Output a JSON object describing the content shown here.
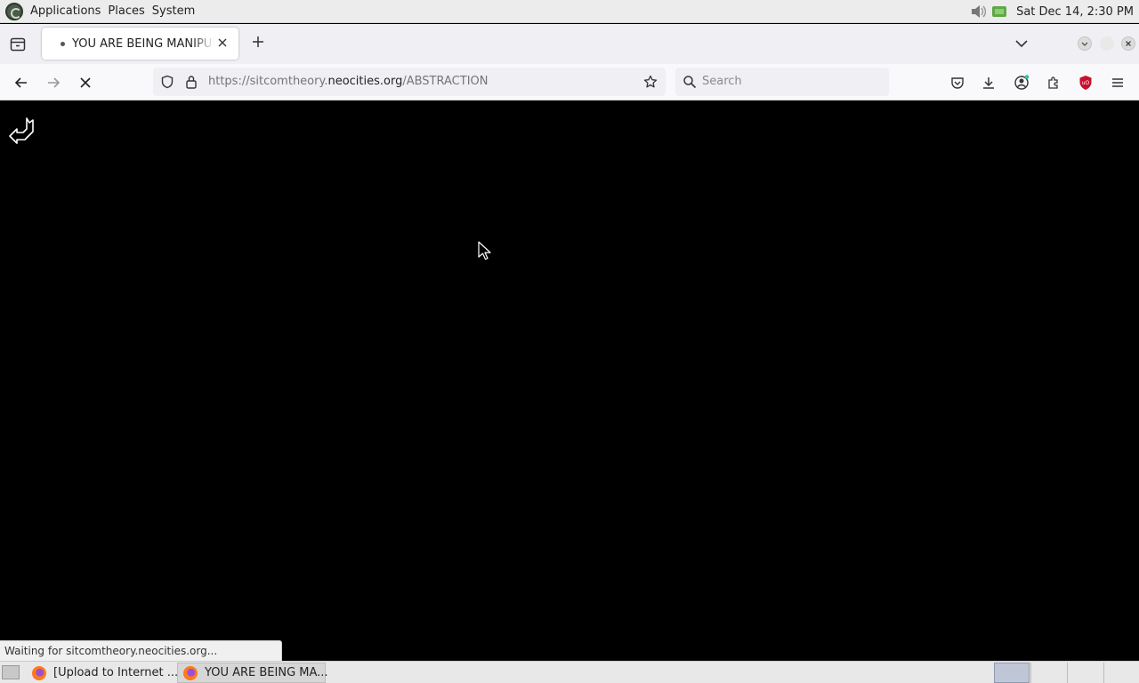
{
  "top_panel": {
    "menus": [
      "Applications",
      "Places",
      "System"
    ],
    "clock": "Sat Dec 14,  2:30 PM"
  },
  "browser": {
    "tab": {
      "title": "YOU ARE BEING MANIPULATED"
    },
    "url": {
      "prefix": "https://sitcomtheory.",
      "host": "neocities.org",
      "path": "/ABSTRACTION"
    },
    "search_placeholder": "Search",
    "status_text": "Waiting for sitcomtheory.neocities.org..."
  },
  "taskbar": {
    "tasks": [
      {
        "label": "[Upload to Internet ...",
        "active": false
      },
      {
        "label": "YOU ARE BEING MA...",
        "active": false
      }
    ]
  },
  "colors": {
    "page_background": "#000000",
    "toolbar_background": "#f9f9fb",
    "tabstrip_background": "#f0f0f4",
    "ublock_red": "#c8102e"
  },
  "icons": {
    "page_logo": "white-outline-arrow-logo",
    "navigation": [
      "back-icon",
      "forward-icon",
      "stop-icon"
    ],
    "toolbar": [
      "pocket-icon",
      "download-icon",
      "account-icon",
      "extensions-icon",
      "ublock-icon",
      "menu-icon"
    ]
  }
}
